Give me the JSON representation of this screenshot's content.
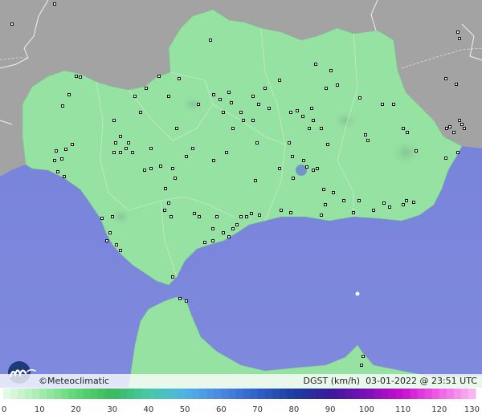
{
  "footer": {
    "brand": "©Meteoclimatic",
    "variable": "DGST (km/h)",
    "datetime": "03-01-2022 @ 23:51 UTC"
  },
  "legend": {
    "ticks": [
      "0",
      "10",
      "20",
      "30",
      "40",
      "50",
      "60",
      "70",
      "80",
      "90",
      "100",
      "110",
      "120",
      "130"
    ],
    "min": 0,
    "max": 130
  },
  "colors": {
    "sea": "#7b87dc",
    "land": "#96e2a2",
    "outside": "#a6a6a6",
    "station_marker": "#000000"
  },
  "icons": {
    "logo": "meteoclimatic-logo-icon"
  }
}
